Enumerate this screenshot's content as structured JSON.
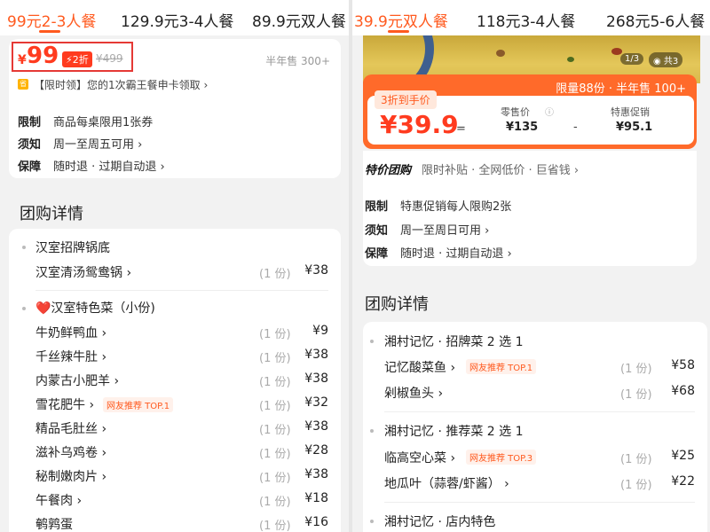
{
  "left": {
    "tabs": [
      {
        "label": "99元2-3人餐",
        "active": true
      },
      {
        "label": "129.9元3-4人餐",
        "active": false
      },
      {
        "label": "89.9元双人餐",
        "active": false
      }
    ],
    "price": {
      "currency": "¥",
      "amount": "99",
      "discount": "2折",
      "original": "¥499"
    },
    "sold": "半年售 300+",
    "promo": {
      "icon": "省",
      "text": "【限时领】您的1次霸王餐申卡领取 ›"
    },
    "rules": [
      {
        "label": "限制",
        "value": "商品每桌限用1张券"
      },
      {
        "label": "须知",
        "value": "周一至周五可用 ›"
      },
      {
        "label": "保障",
        "value": "随时退 · 过期自动退 ›"
      }
    ],
    "details_title": "团购详情",
    "groups": [
      {
        "title": "汉室招牌锅底",
        "items": [
          {
            "name": "汉室清汤鸳鸯锅 ›",
            "qty": "(1 份)",
            "price": "¥38",
            "badge": ""
          }
        ]
      },
      {
        "title": "❤️汉室特色菜（小份)",
        "items": [
          {
            "name": "牛奶鲜鸭血 ›",
            "qty": "(1 份)",
            "price": "¥9",
            "badge": ""
          },
          {
            "name": "千丝辣牛肚 ›",
            "qty": "(1 份)",
            "price": "¥38",
            "badge": ""
          },
          {
            "name": "内蒙古小肥羊 ›",
            "qty": "(1 份)",
            "price": "¥38",
            "badge": ""
          },
          {
            "name": "雪花肥牛 ›",
            "qty": "(1 份)",
            "price": "¥32",
            "badge": "网友推荐 TOP.1"
          },
          {
            "name": "精品毛肚丝 ›",
            "qty": "(1 份)",
            "price": "¥38",
            "badge": ""
          },
          {
            "name": "滋补乌鸡卷 ›",
            "qty": "(1 份)",
            "price": "¥28",
            "badge": ""
          },
          {
            "name": "秘制嫩肉片 ›",
            "qty": "(1 份)",
            "price": "¥38",
            "badge": ""
          },
          {
            "name": "午餐肉 ›",
            "qty": "(1 份)",
            "price": "¥18",
            "badge": ""
          },
          {
            "name": "鹌鹑蛋",
            "qty": "(1 份)",
            "price": "¥16",
            "badge": ""
          }
        ]
      }
    ]
  },
  "right": {
    "tabs": [
      {
        "label": "39.9元双人餐",
        "active": true
      },
      {
        "label": "118元3-4人餐",
        "active": false
      },
      {
        "label": "268元5-6人餐",
        "active": false
      }
    ],
    "image_counter": "1/3",
    "image_total": "共3",
    "deal": {
      "limit_sold": "限量88份 · 半年售 100+",
      "tag": "3折到手价",
      "price": "¥39.9",
      "eq": "=",
      "retail_label": "零售价",
      "retail_value": "¥135",
      "minus": "-",
      "special_label": "特惠促销",
      "special_value": "¥95.1"
    },
    "special": {
      "brand": "特价团购",
      "text": "限时补贴 · 全网低价 · 巨省钱 ›"
    },
    "rules": [
      {
        "label": "限制",
        "value": "特惠促销每人限购2张"
      },
      {
        "label": "须知",
        "value": "周一至周日可用 ›"
      },
      {
        "label": "保障",
        "value": "随时退 · 过期自动退 ›"
      }
    ],
    "details_title": "团购详情",
    "groups": [
      {
        "title": "湘村记忆 · 招牌菜 2 选 1",
        "items": [
          {
            "name": "记忆酸菜鱼 ›",
            "qty": "(1 份)",
            "price": "¥58",
            "badge": "网友推荐 TOP.1"
          },
          {
            "name": "剁椒鱼头 ›",
            "qty": "(1 份)",
            "price": "¥68",
            "badge": ""
          }
        ]
      },
      {
        "title": "湘村记忆 · 推荐菜 2 选 1",
        "items": [
          {
            "name": "临高空心菜 ›",
            "qty": "(1 份)",
            "price": "¥25",
            "badge": "网友推荐 TOP.3"
          },
          {
            "name": "地瓜叶（蒜蓉/虾酱） ›",
            "qty": "(1 份)",
            "price": "¥22",
            "badge": ""
          }
        ]
      },
      {
        "title": "湘村记忆 · 店内特色",
        "items": []
      }
    ]
  },
  "colors": {
    "accent": "#ff5a1f",
    "highlight_box": "#e53935"
  }
}
